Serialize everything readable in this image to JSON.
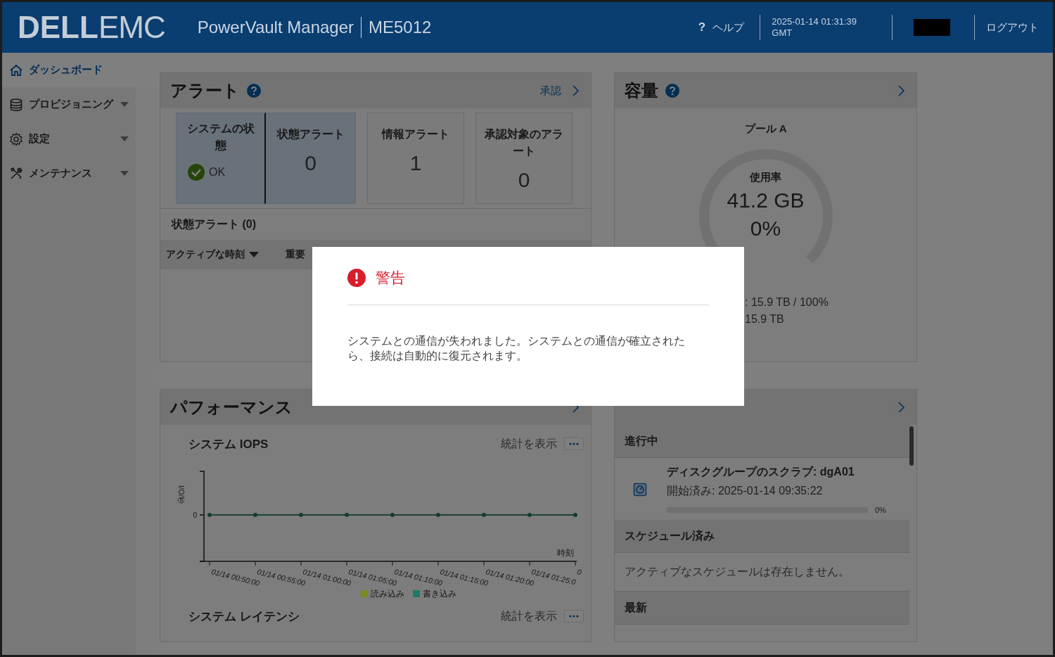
{
  "header": {
    "logo": {
      "brand": "DELL",
      "suffix": "EMC"
    },
    "product": "PowerVault Manager",
    "model": "ME5012",
    "help": {
      "icon": "?",
      "label": "ヘルプ"
    },
    "datetime": "2025-01-14 01:31:39",
    "timezone": "GMT",
    "logout": "ログアウト"
  },
  "sidebar": {
    "items": [
      {
        "label": "ダッシュボード",
        "selected": true,
        "expandable": false
      },
      {
        "label": "プロビジョニング",
        "selected": false,
        "expandable": true
      },
      {
        "label": "設定",
        "selected": false,
        "expandable": true
      },
      {
        "label": "メンテナンス",
        "selected": false,
        "expandable": true
      }
    ]
  },
  "alerts": {
    "title": "アラート",
    "acknowledge": "承認",
    "tiles": [
      {
        "kind": "status",
        "label": "システムの状態",
        "value": "OK",
        "selected": true
      },
      {
        "kind": "count",
        "label": "状態アラート",
        "value": "0",
        "selected": true
      },
      {
        "kind": "count",
        "label": "情報アラート",
        "value": "1",
        "selected": false
      },
      {
        "kind": "count",
        "label": "承認対象のアラート",
        "value": "0",
        "selected": false
      }
    ],
    "table": {
      "title": "状態アラート (0)",
      "columns": [
        {
          "label": "アクティブな時刻",
          "sorted": true
        },
        {
          "label": "重要",
          "sorted": false
        }
      ]
    }
  },
  "capacity": {
    "title": "容量",
    "pool": "プール A",
    "gauge": {
      "label": "使用率",
      "used": "41.2 GB",
      "percent": "0%",
      "level": 0
    },
    "lines": [
      ": 15.9 TB / 100%",
      "15.9 TB"
    ]
  },
  "performance": {
    "title": "パフォーマンス",
    "charts": [
      {
        "title": "システム IOPS",
        "stats": "統計を表示",
        "chart": {
          "kind": "line",
          "x_axis_label": "時刻",
          "y_axis_label": "I/O/秒",
          "y_tick": "0",
          "x_labels": [
            "01/14 00:50:00",
            "01/14 00:55:00",
            "01/14 01:00:00",
            "01/14 01:05:00",
            "01/14 01:10:00",
            "01/14 01:15:00",
            "01/14 01:20:00",
            "01/14 01:25:0",
            "0"
          ],
          "legend": [
            {
              "name": "読み込み",
              "color": "#7a8a1c"
            },
            {
              "name": "書き込み",
              "color": "#1f7a6a"
            }
          ]
        }
      },
      {
        "title": "システム レイテンシ",
        "stats": "統計を表示"
      }
    ]
  },
  "activity": {
    "sections": [
      {
        "heading": "進行中",
        "items": [
          {
            "title": "ディスクグループのスクラブ: dgA01",
            "started": "開始済み: 2025-01-14 09:35:22",
            "level": 0,
            "percent": "0%"
          }
        ]
      },
      {
        "heading": "スケジュール済み",
        "message": "アクティブなスケジュールは存在しません。"
      },
      {
        "heading": "最新"
      }
    ]
  },
  "dialog": {
    "title": "警告",
    "message": "システムとの通信が失われました。システムとの通信が確立されたら、接続は自動的に復元されます。"
  }
}
